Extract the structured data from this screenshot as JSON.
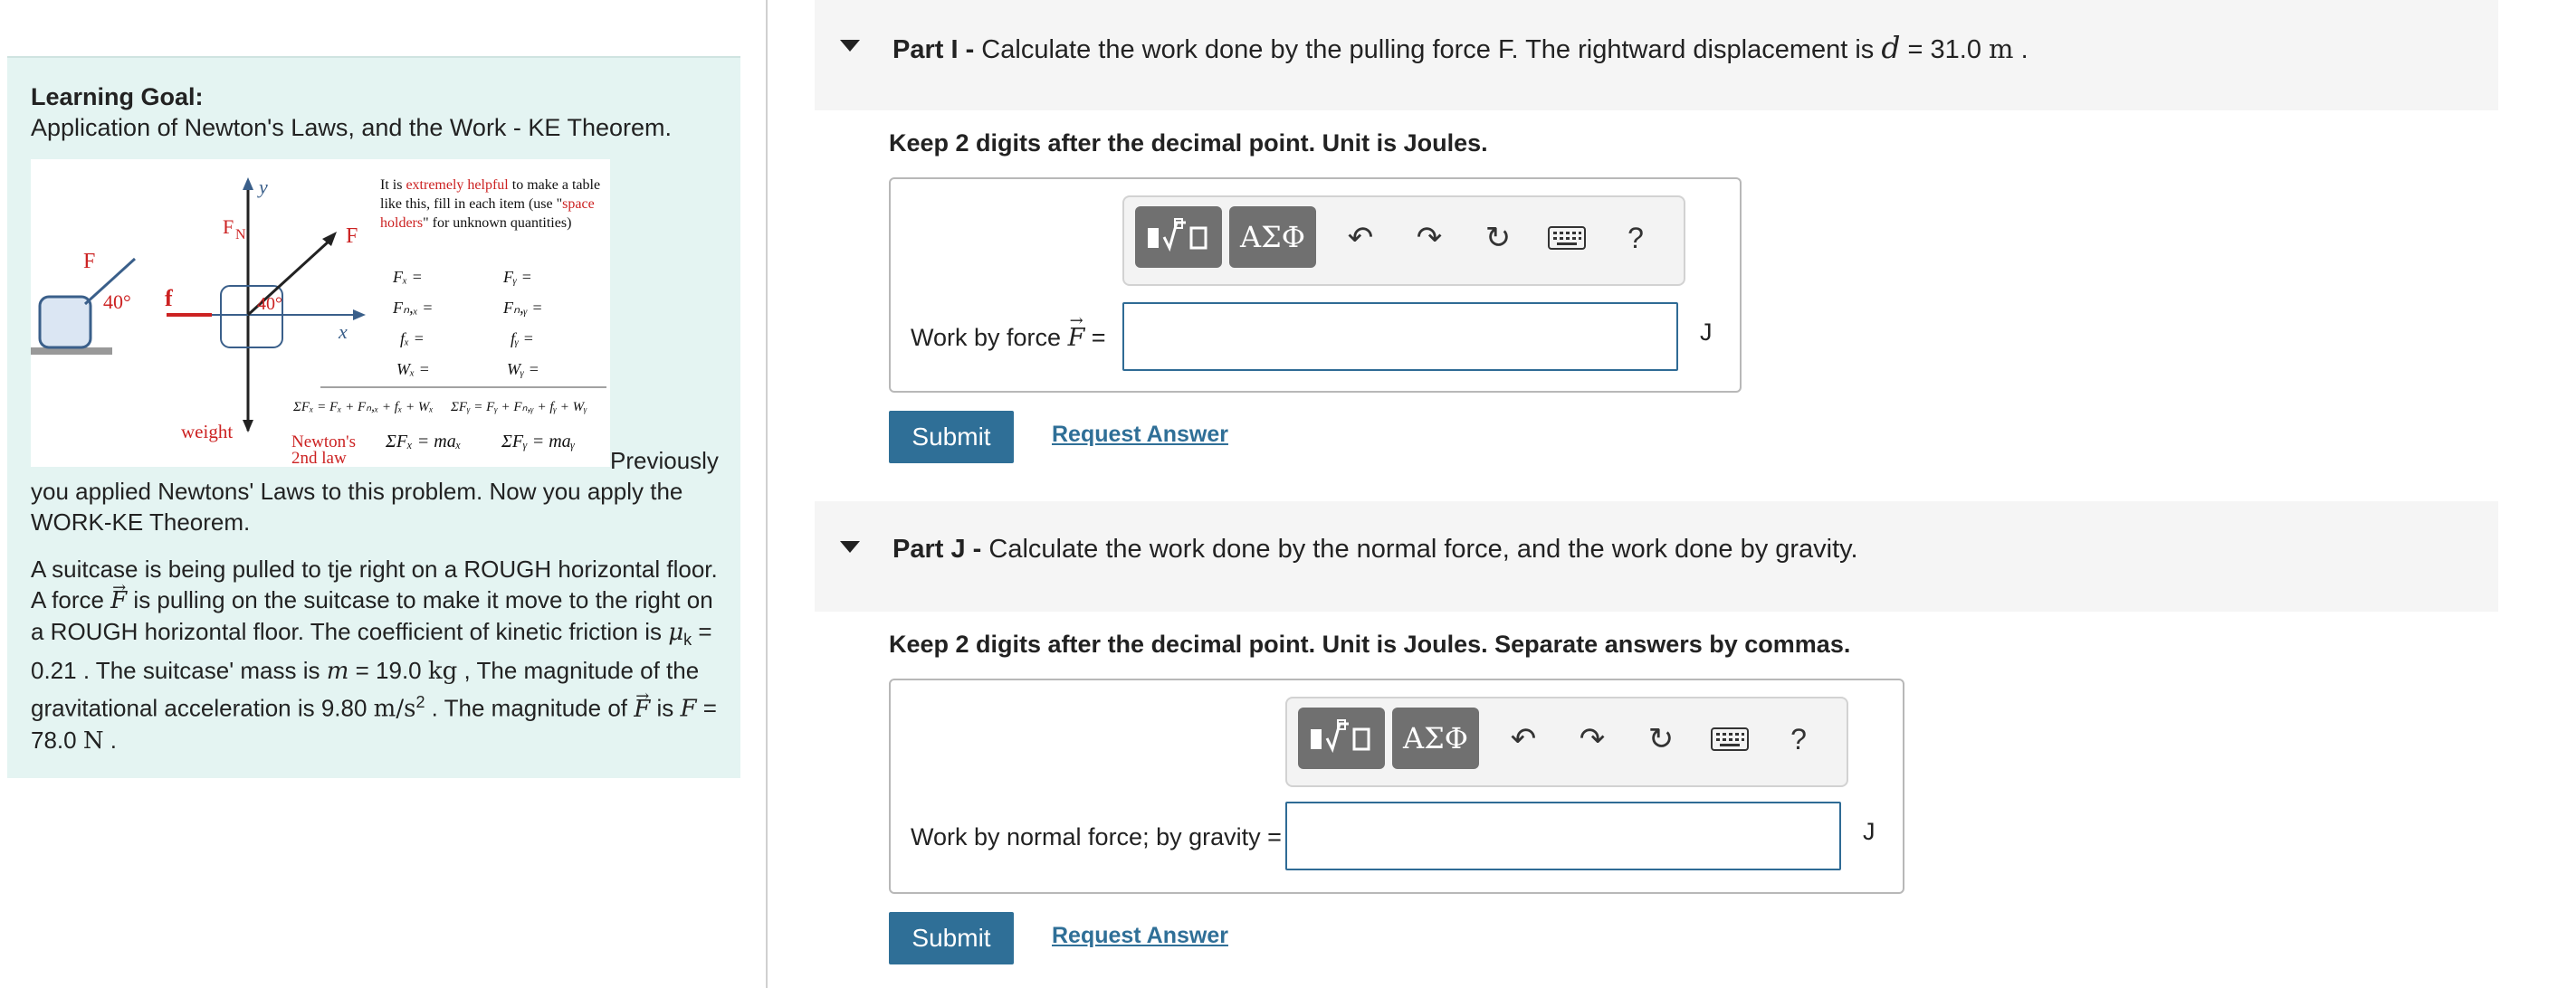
{
  "left": {
    "goal_title": "Learning Goal:",
    "goal_subtitle": "Application of Newton's Laws, and the Work - KE Theorem.",
    "figure": {
      "note_parts": [
        "It is ",
        "extremely helpful",
        " to make a table like this, fill in each item (use \"",
        "space holders",
        "\" for unknown quantities)"
      ],
      "labels": {
        "F_left": "F",
        "angle_left": "40°",
        "f": "f",
        "y": "y",
        "FN": "F",
        "FN_sub": "N",
        "F_right": "F",
        "angle_right": "40°",
        "x": "x",
        "weight": "weight",
        "newton1": "Newton's",
        "newton2": "2nd law"
      },
      "table": [
        [
          "Fₓ =",
          "Fᵧ ="
        ],
        [
          "Fₙ,ₓ =",
          "Fₙ,ᵧ ="
        ],
        [
          "fₓ =",
          "fᵧ ="
        ],
        [
          "Wₓ =",
          "Wᵧ ="
        ]
      ],
      "sums": [
        "ΣFₓ = Fₓ + Fₙ,ₓ + fₓ + Wₓ",
        "ΣFᵧ = Fᵧ + Fₙ,ᵧ + fᵧ + Wᵧ"
      ],
      "newton": [
        "ΣFₓ = maₓ",
        "ΣFᵧ = maᵧ"
      ]
    },
    "previously": "Previously you applied Newtons' Laws to this problem. Now you apply the WORK-KE Theorem.",
    "problem": {
      "t1": "A suitcase is being pulled to tje right on a ROUGH horizontal floor. A force ",
      "F": "F",
      "t2": " is pulling on the suitcase to make it move to the right on a ROUGH horizontal floor. The coefficient of kinetic friction is ",
      "mu": "μ",
      "mu_sub": "k",
      "mu_val": " = 0.21",
      "t3": " . The suitcase' mass is ",
      "m": "m",
      "m_val": " = 19.0 ",
      "kg": "kg",
      "t4": " , The magnitude of the gravitational acceleration is 9.80 ",
      "accel": "m/s",
      "accel_exp": "2",
      "t5": " . The magnitude of ",
      "F2": "F",
      "t6": " is ",
      "F3": "F",
      "F_val": " = 78.0 ",
      "N": "N",
      "t7": " ."
    }
  },
  "parts": [
    {
      "label": "Part I -",
      "question": " Calculate the work done by the pulling force F. The rightward displacement is ",
      "d": "d",
      "d_val": " = 31.0 ",
      "d_unit": "m",
      "end": " .",
      "instruction": "Keep 2 digits after the decimal point. Unit is Joules.",
      "answer_label": "Work by force ",
      "answer_vec": "F",
      "answer_eq": " =",
      "unit": "J",
      "submit": "Submit",
      "request": "Request Answer"
    },
    {
      "label": "Part J -",
      "question": " Calculate the work done by the normal force, and the work done by gravity.",
      "instruction": "Keep 2 digits after the decimal point. Unit is Joules. Separate answers by commas.",
      "answer_label": "Work by normal force; by gravity =",
      "unit": "J",
      "submit": "Submit",
      "request": "Request Answer"
    }
  ],
  "toolbar": {
    "template_icon": "templates-icon",
    "greek": "ΑΣΦ",
    "undo_icon": "undo-icon",
    "redo_icon": "redo-icon",
    "reset_icon": "reset-icon",
    "keyboard_icon": "keyboard-icon",
    "help": "?"
  },
  "colors": {
    "accent": "#2f6f97",
    "panel": "#e4f4f2",
    "red": "#dd1111"
  }
}
